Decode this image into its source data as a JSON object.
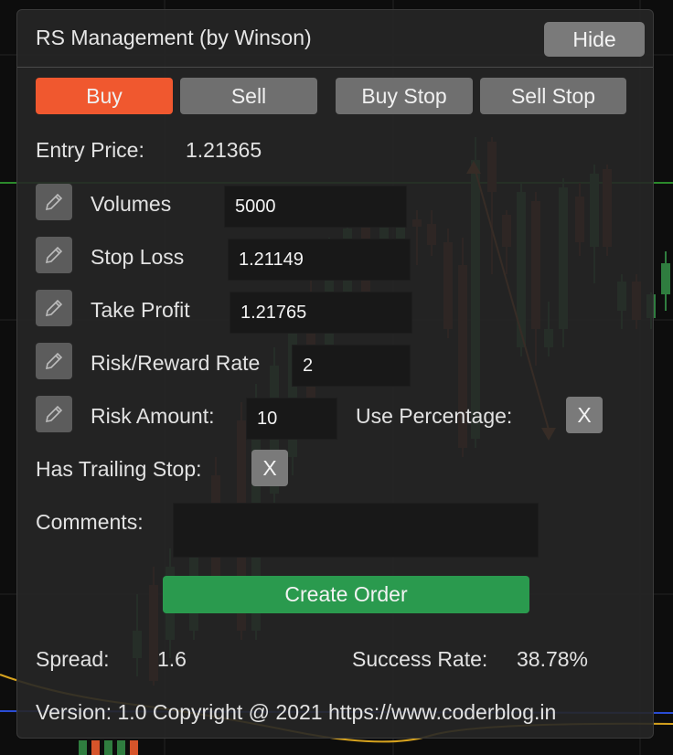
{
  "panel": {
    "title": "RS Management (by Winson)",
    "hide_label": "Hide"
  },
  "tabs": [
    {
      "label": "Buy",
      "active": true
    },
    {
      "label": "Sell",
      "active": false
    },
    {
      "label": "Buy Stop",
      "active": false
    },
    {
      "label": "Sell Stop",
      "active": false
    }
  ],
  "entry": {
    "label": "Entry Price:",
    "value": "1.21365"
  },
  "fields": {
    "volumes": {
      "label": "Volumes",
      "value": "5000"
    },
    "stop_loss": {
      "label": "Stop Loss",
      "value": "1.21149"
    },
    "take_profit": {
      "label": "Take Profit",
      "value": "1.21765"
    },
    "risk_reward": {
      "label": "Risk/Reward Rate",
      "value": "2"
    },
    "risk_amount": {
      "label": "Risk Amount:",
      "value": "10"
    }
  },
  "use_percentage": {
    "label": "Use Percentage:",
    "toggle": "X"
  },
  "trailing_stop": {
    "label": "Has Trailing Stop:",
    "toggle": "X"
  },
  "comments": {
    "label": "Comments:",
    "value": ""
  },
  "create_label": "Create Order",
  "spread": {
    "label": "Spread:",
    "value": "1.6"
  },
  "success_rate": {
    "label": "Success Rate:",
    "value": "38.78%"
  },
  "footer": "Version: 1.0  Copyright @ 2021 https://www.coderblog.in",
  "colors": {
    "accent_buy": "#f0582f",
    "create_green": "#2a9a4e",
    "bull_candle": "#2f7d3f",
    "bear_candle": "#7a2a1a"
  },
  "icons": {
    "edit": "pencil-icon"
  }
}
